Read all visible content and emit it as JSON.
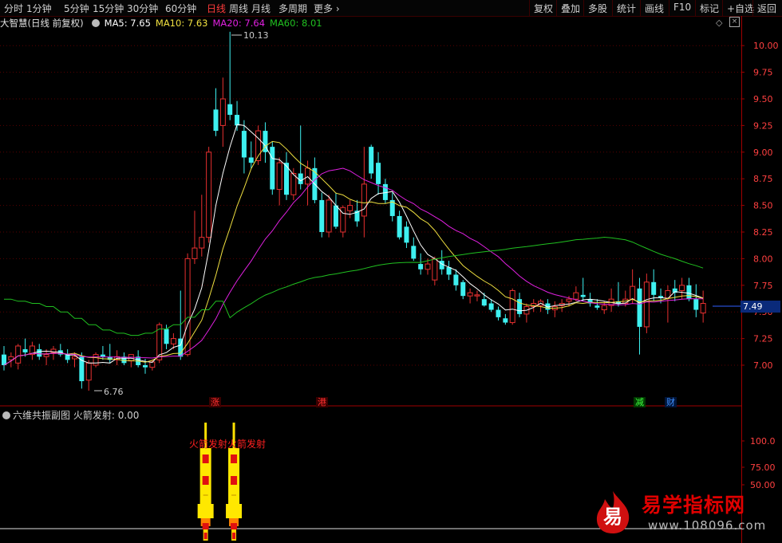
{
  "toolbar": {
    "left_tabs": [
      "分时",
      "1分钟",
      "5分钟",
      "15分钟",
      "30分钟",
      "60分钟",
      "日线",
      "周线",
      "月线",
      "多周期",
      "更多"
    ],
    "active_tab": "日线",
    "right_buttons": [
      "复权",
      "叠加",
      "多股",
      "统计",
      "画线",
      "F10",
      "标记",
      "+自选",
      "返回"
    ]
  },
  "infobar": {
    "title": "大智慧(日线 前复权)",
    "ma5": "MA5: 7.65",
    "ma10": "MA10: 7.63",
    "ma20": "MA20: 7.64",
    "ma60": "MA60: 8.01"
  },
  "colors": {
    "up": "#e83030",
    "down": "#3ef0f0",
    "ma5": "#ffffff",
    "ma10": "#f0e040",
    "ma20": "#e020e0",
    "ma60": "#20c020",
    "axis": "#a00000"
  },
  "price_axis": {
    "labels": [
      "10.00",
      "9.75",
      "9.50",
      "9.25",
      "9.00",
      "8.75",
      "8.50",
      "8.25",
      "8.00",
      "7.75",
      "7.50",
      "7.25",
      "7.00"
    ],
    "min": 6.8,
    "max": 10.2
  },
  "current_price": "7.49",
  "high_label": "10.13",
  "low_label": "6.76",
  "markers": [
    "涨",
    "港",
    "减",
    "财"
  ],
  "indicator": {
    "title": "六维共振副图",
    "value_label": "火箭发射: 0.00",
    "axis_labels": [
      "100.0",
      "75.00",
      "50.00"
    ],
    "rocket_text": "火箭发射火箭发射"
  },
  "watermark": {
    "icon_char": "易",
    "title": "易学指标网",
    "url": "www.108096.com"
  },
  "chart_data": {
    "type": "candlestick",
    "note_series": [
      "open",
      "high",
      "low",
      "close"
    ],
    "candles": [
      [
        7.1,
        7.18,
        6.95,
        7.0
      ],
      [
        7.05,
        7.12,
        6.98,
        7.08
      ],
      [
        7.02,
        7.2,
        6.96,
        7.18
      ],
      [
        7.15,
        7.25,
        7.08,
        7.12
      ],
      [
        7.1,
        7.22,
        7.05,
        7.18
      ],
      [
        7.15,
        7.2,
        7.05,
        7.08
      ],
      [
        7.08,
        7.15,
        7.0,
        7.1
      ],
      [
        7.12,
        7.18,
        7.05,
        7.15
      ],
      [
        7.14,
        7.2,
        7.08,
        7.1
      ],
      [
        7.1,
        7.15,
        7.02,
        7.05
      ],
      [
        7.06,
        7.12,
        6.98,
        7.08
      ],
      [
        7.08,
        7.12,
        6.78,
        6.85
      ],
      [
        6.86,
        7.05,
        6.76,
        7.02
      ],
      [
        7.0,
        7.12,
        6.98,
        7.1
      ],
      [
        7.1,
        7.18,
        7.05,
        7.08
      ],
      [
        7.08,
        7.2,
        7.02,
        7.05
      ],
      [
        7.05,
        7.14,
        7.0,
        7.08
      ],
      [
        7.08,
        7.12,
        7.0,
        7.02
      ],
      [
        7.04,
        7.1,
        6.98,
        7.1
      ],
      [
        7.08,
        7.14,
        6.98,
        7.0
      ],
      [
        7.0,
        7.06,
        6.92,
        6.98
      ],
      [
        6.98,
        7.05,
        6.95,
        7.03
      ],
      [
        7.05,
        7.4,
        7.02,
        7.38
      ],
      [
        7.34,
        7.38,
        7.15,
        7.2
      ],
      [
        7.2,
        7.3,
        7.15,
        7.25
      ],
      [
        7.25,
        7.7,
        7.05,
        7.08
      ],
      [
        7.1,
        8.05,
        7.08,
        8.0
      ],
      [
        8.0,
        8.45,
        7.95,
        8.1
      ],
      [
        8.1,
        8.6,
        8.02,
        8.2
      ],
      [
        8.2,
        9.05,
        8.15,
        9.0
      ],
      [
        9.4,
        9.6,
        9.15,
        9.2
      ],
      [
        9.25,
        9.7,
        9.05,
        9.5
      ],
      [
        9.45,
        10.13,
        9.3,
        9.35
      ],
      [
        9.35,
        9.48,
        9.2,
        9.25
      ],
      [
        9.2,
        9.3,
        8.8,
        8.95
      ],
      [
        8.95,
        9.1,
        8.85,
        8.9
      ],
      [
        8.92,
        9.25,
        8.88,
        9.2
      ],
      [
        9.2,
        9.28,
        8.9,
        9.0
      ],
      [
        9.05,
        9.1,
        8.6,
        8.65
      ],
      [
        8.65,
        8.95,
        8.5,
        8.9
      ],
      [
        8.9,
        9.0,
        8.55,
        8.6
      ],
      [
        8.6,
        8.85,
        8.55,
        8.8
      ],
      [
        8.8,
        9.25,
        8.65,
        8.7
      ],
      [
        8.7,
        8.92,
        8.5,
        8.85
      ],
      [
        8.85,
        8.95,
        8.52,
        8.55
      ],
      [
        8.55,
        8.62,
        8.2,
        8.25
      ],
      [
        8.25,
        8.6,
        8.2,
        8.55
      ],
      [
        8.5,
        8.62,
        8.28,
        8.3
      ],
      [
        8.25,
        8.5,
        8.2,
        8.48
      ],
      [
        8.45,
        8.55,
        8.38,
        8.5
      ],
      [
        8.45,
        8.55,
        8.3,
        8.35
      ],
      [
        8.4,
        9.05,
        8.2,
        8.7
      ],
      [
        9.05,
        9.07,
        8.75,
        8.8
      ],
      [
        8.9,
        9.0,
        8.6,
        8.7
      ],
      [
        8.7,
        8.75,
        8.52,
        8.55
      ],
      [
        8.55,
        8.62,
        8.35,
        8.4
      ],
      [
        8.4,
        8.45,
        8.18,
        8.2
      ],
      [
        8.3,
        8.35,
        8.1,
        8.15
      ],
      [
        8.12,
        8.2,
        7.98,
        8.0
      ],
      [
        7.95,
        8.05,
        7.85,
        7.9
      ],
      [
        7.9,
        8.0,
        7.85,
        7.95
      ],
      [
        7.8,
        8.02,
        7.75,
        8.0
      ],
      [
        7.98,
        8.08,
        7.85,
        7.9
      ],
      [
        7.92,
        7.98,
        7.8,
        7.85
      ],
      [
        7.85,
        7.9,
        7.7,
        7.75
      ],
      [
        7.78,
        7.8,
        7.62,
        7.65
      ],
      [
        7.65,
        7.72,
        7.58,
        7.68
      ],
      [
        7.65,
        7.7,
        7.6,
        7.66
      ],
      [
        7.62,
        7.68,
        7.55,
        7.56
      ],
      [
        7.58,
        7.62,
        7.5,
        7.52
      ],
      [
        7.52,
        7.55,
        7.42,
        7.45
      ],
      [
        7.44,
        7.48,
        7.38,
        7.4
      ],
      [
        7.4,
        7.72,
        7.38,
        7.7
      ],
      [
        7.62,
        7.68,
        7.45,
        7.48
      ],
      [
        7.48,
        7.58,
        7.4,
        7.55
      ],
      [
        7.55,
        7.62,
        7.5,
        7.58
      ],
      [
        7.56,
        7.62,
        7.5,
        7.6
      ],
      [
        7.58,
        7.62,
        7.48,
        7.52
      ],
      [
        7.52,
        7.6,
        7.45,
        7.55
      ],
      [
        7.56,
        7.62,
        7.5,
        7.58
      ],
      [
        7.6,
        7.65,
        7.55,
        7.62
      ],
      [
        7.62,
        7.74,
        7.6,
        7.68
      ],
      [
        7.66,
        7.82,
        7.6,
        7.64
      ],
      [
        7.62,
        7.68,
        7.55,
        7.58
      ],
      [
        7.56,
        7.62,
        7.52,
        7.54
      ],
      [
        7.52,
        7.6,
        7.48,
        7.56
      ],
      [
        7.56,
        7.72,
        7.5,
        7.62
      ],
      [
        7.6,
        7.78,
        7.55,
        7.58
      ],
      [
        7.58,
        7.7,
        7.55,
        7.62
      ],
      [
        7.62,
        7.9,
        7.58,
        7.74
      ],
      [
        7.72,
        7.82,
        7.1,
        7.36
      ],
      [
        7.36,
        7.86,
        7.3,
        7.78
      ],
      [
        7.78,
        7.9,
        7.6,
        7.66
      ],
      [
        7.65,
        7.72,
        7.58,
        7.63
      ],
      [
        7.63,
        7.75,
        7.4,
        7.7
      ],
      [
        7.72,
        7.8,
        7.6,
        7.68
      ],
      [
        7.7,
        7.82,
        7.62,
        7.75
      ],
      [
        7.75,
        7.82,
        7.6,
        7.62
      ],
      [
        7.62,
        7.76,
        7.45,
        7.52
      ],
      [
        7.49,
        7.7,
        7.4,
        7.58
      ]
    ],
    "ma_note": "MA lines computed from closes (5,10,20,60)",
    "indicator_rockets": [
      29,
      33
    ]
  }
}
